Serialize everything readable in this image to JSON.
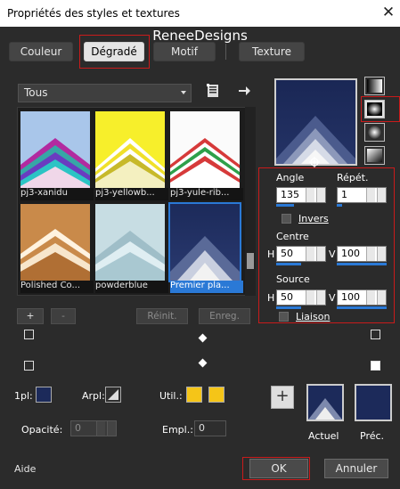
{
  "window": {
    "title": "Propriétés des styles et textures",
    "close_glyph": "✕"
  },
  "watermark": "ReneeDesigns",
  "tabs": [
    {
      "label": "Couleur"
    },
    {
      "label": "Dégradé"
    },
    {
      "label": "Motif"
    },
    {
      "label": "Texture"
    }
  ],
  "library": {
    "selected": "Tous",
    "items": [
      {
        "label": "pj3-xanidu"
      },
      {
        "label": "pj3-yellowb..."
      },
      {
        "label": "pj3-yule-rib..."
      },
      {
        "label": "Polished Co..."
      },
      {
        "label": "powderblue"
      },
      {
        "label": "Premier pla..."
      }
    ],
    "add": "+",
    "remove": "-",
    "reset": "Réinit.",
    "save": "Enreg."
  },
  "gradient": {
    "angle_label": "Angle",
    "angle": "135",
    "repeat_label": "Répét.",
    "repeat": "1",
    "invert_label": "Invers",
    "invert_checked": false,
    "center_label": "Centre",
    "center_h_label": "H",
    "center_h": "50",
    "center_v_label": "V",
    "center_v": "100",
    "source_label": "Source",
    "source_h_label": "H",
    "source_h": "50",
    "source_v_label": "V",
    "source_v": "100",
    "link_label": "Liaison",
    "link_checked": false,
    "stop_color_start": "#1c2a5a",
    "stop_color_end": "#f2f2f2"
  },
  "props": {
    "fg_label": "1pl:",
    "bg_label": "Arpl:",
    "use_label": "Util.:",
    "opacity_label": "Opacité:",
    "opacity": "0",
    "location_label": "Empl.:",
    "location": "0",
    "add": "+",
    "current_label": "Actuel",
    "previous_label": "Préc.",
    "use_color": "#f5c518",
    "fg_color": "#1c2a5a"
  },
  "footer": {
    "help": "Aide",
    "ok": "OK",
    "cancel": "Annuler"
  },
  "colors": {
    "accent": "#2a79d6",
    "highlight": "#c91b1b",
    "navy": "#1c2a5a"
  }
}
